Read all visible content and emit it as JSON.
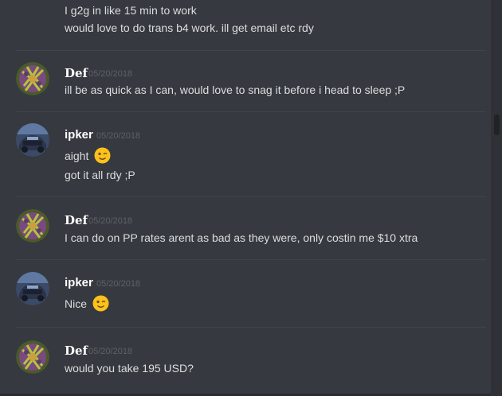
{
  "continuation": [
    "I g2g in like 15 min to work",
    "would love to do trans b4 work. ill get email etc rdy"
  ],
  "messages": [
    {
      "author": "Def",
      "timestamp": "05/20/2018",
      "lines": [
        "ill be as quick as I can, would love to snag it before i head to sleep ;P"
      ]
    },
    {
      "author": "ipker",
      "timestamp": "05/20/2018",
      "lines": [
        "aight",
        "got it all rdy ;P"
      ]
    },
    {
      "author": "Def",
      "timestamp": "05/20/2018",
      "lines": [
        "I can do on PP rates arent as bad as they were, only costin me $10 xtra"
      ]
    },
    {
      "author": "ipker",
      "timestamp": "05/20/2018",
      "lines": [
        "Nice"
      ]
    },
    {
      "author": "Def",
      "timestamp": "05/20/2018",
      "lines": [
        "would you take 195 USD?"
      ]
    }
  ],
  "icons": {
    "emoji": "winking-face-icon",
    "avatar_def": "def-avatar",
    "avatar_ipker": "ipker-avatar"
  },
  "colors": {
    "background": "#36393f",
    "text": "#dcddde",
    "username": "#ffffff",
    "timestamp": "#5e6268",
    "emoji": "#fcc21b"
  }
}
